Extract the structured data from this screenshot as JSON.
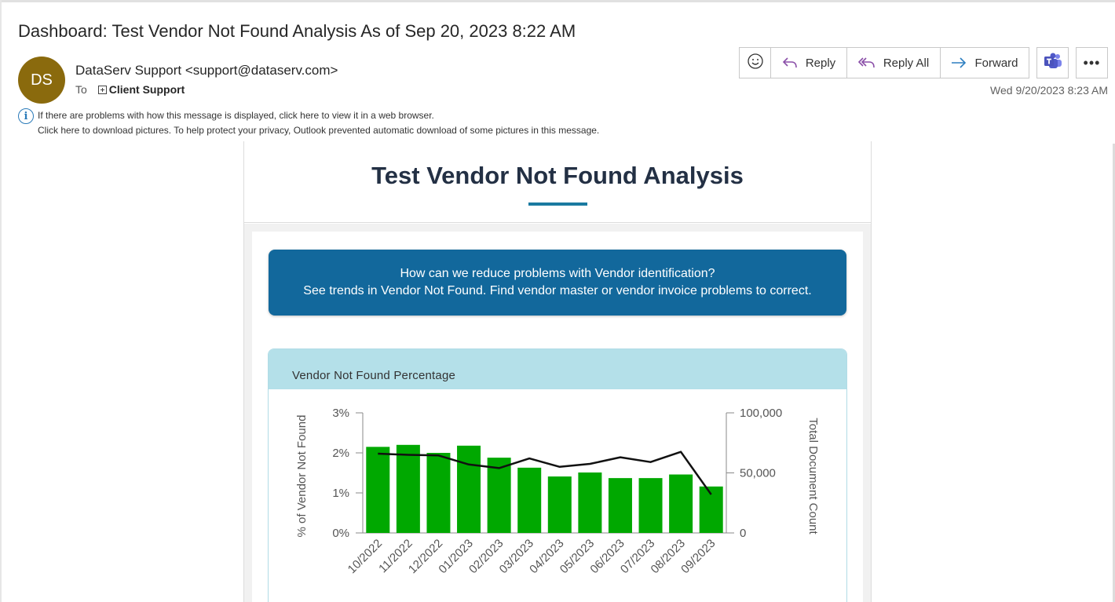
{
  "email": {
    "subject": "Dashboard: Test Vendor Not Found Analysis As of Sep 20, 2023 8:22 AM",
    "avatar_initials": "DS",
    "avatar_color": "#8a6a0d",
    "sender": "DataServ Support <support@dataserv.com>",
    "to_label": "To",
    "to_name": "Client Support",
    "date": "Wed 9/20/2023 8:23 AM",
    "info_line1": "If there are problems with how this message is displayed, click here to view it in a web browser.",
    "info_line2": "Click here to download pictures. To help protect your privacy, Outlook prevented automatic download of some pictures in this message."
  },
  "toolbar": {
    "reply_label": "Reply",
    "reply_all_label": "Reply All",
    "forward_label": "Forward",
    "more_label": "•••"
  },
  "body": {
    "title": "Test Vendor Not Found Analysis",
    "accent_color": "#1a7aa0",
    "banner_line1": "How can we reduce problems with Vendor identification?",
    "banner_line2": "See trends in Vendor Not Found.  Find vendor master or vendor invoice problems to correct.",
    "banner_color": "#12689c",
    "chart_header": "Vendor Not Found Percentage"
  },
  "chart_data": {
    "type": "bar",
    "title": "Vendor Not Found Percentage",
    "categories": [
      "10/2022",
      "11/2022",
      "12/2022",
      "01/2023",
      "02/2023",
      "03/2023",
      "04/2023",
      "05/2023",
      "06/2023",
      "07/2023",
      "08/2023",
      "09/2023"
    ],
    "series": [
      {
        "type": "bar",
        "axis": "left",
        "color": "#00a800",
        "values": [
          2.15,
          2.2,
          2.0,
          2.18,
          1.88,
          1.63,
          1.41,
          1.51,
          1.37,
          1.37,
          1.46,
          1.16
        ]
      },
      {
        "type": "line",
        "axis": "right",
        "color": "#111111",
        "values": [
          66000,
          65000,
          64500,
          57000,
          54000,
          62000,
          55000,
          57500,
          63000,
          59000,
          67500,
          32000
        ]
      }
    ],
    "ylabel": "% of Vendor Not Found",
    "y2label": "Total Document Count",
    "ylim": [
      0,
      3
    ],
    "y2lim": [
      0,
      100000
    ],
    "yticks": [
      "0%",
      "1%",
      "2%",
      "3%"
    ],
    "y2ticks": [
      "0",
      "50,000",
      "100,000"
    ],
    "grid": false,
    "legend": "none"
  }
}
